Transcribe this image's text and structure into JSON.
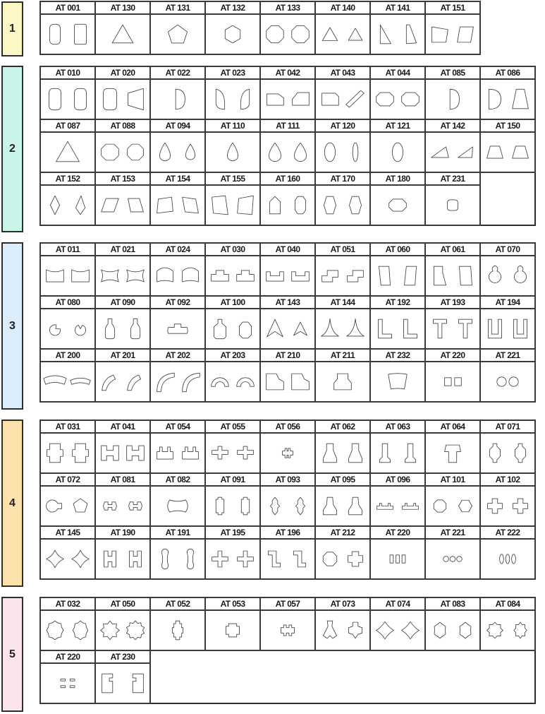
{
  "groups": [
    {
      "label": "1",
      "color": "#fbf8c6",
      "rows": [
        [
          "AT 001",
          "AT 130",
          "AT 131",
          "AT 132",
          "AT 133",
          "AT 140",
          "AT 141",
          "AT 151"
        ]
      ]
    },
    {
      "label": "2",
      "color": "#c9f4ea",
      "rows": [
        [
          "AT 010",
          "AT 020",
          "AT 022",
          "AT 023",
          "AT 042",
          "AT 043",
          "AT 044",
          "AT 085",
          "AT 086"
        ],
        [
          "AT 087",
          "AT 088",
          "AT 094",
          "AT 110",
          "AT 111",
          "AT 120",
          "AT 121",
          "AT 142",
          "AT 150"
        ],
        [
          "AT 152",
          "AT 153",
          "AT 154",
          "AT 155",
          "AT 160",
          "AT 170",
          "AT 180",
          "AT 231"
        ]
      ]
    },
    {
      "label": "3",
      "color": "#dbedfb",
      "rows": [
        [
          "AT 011",
          "AT 021",
          "AT 024",
          "AT 030",
          "AT 040",
          "AT 051",
          "AT 060",
          "AT 061",
          "AT 070"
        ],
        [
          "AT 080",
          "AT 090",
          "AT 092",
          "AT 100",
          "AT 143",
          "AT 144",
          "AT 192",
          "AT 193",
          "AT 194"
        ],
        [
          "AT 200",
          "AT 201",
          "AT 202",
          "AT 203",
          "AT 210",
          "AT 211",
          "AT 232",
          "AT 220",
          "AT 221"
        ]
      ]
    },
    {
      "label": "4",
      "color": "#fce1ad",
      "rows": [
        [
          "AT 031",
          "AT 041",
          "AT 054",
          "AT 055",
          "AT 056",
          "AT 062",
          "AT 063",
          "AT 064",
          "AT 071"
        ],
        [
          "AT 072",
          "AT 081",
          "AT 082",
          "AT 091",
          "AT 093",
          "AT 095",
          "AT 096",
          "AT 101",
          "AT 102"
        ],
        [
          "AT 145",
          "AT 190",
          "AT 191",
          "AT 195",
          "AT 196",
          "AT 212",
          "AT 220",
          "AT 221",
          "AT 222"
        ]
      ]
    },
    {
      "label": "5",
      "color": "#fce4ee",
      "rows": [
        [
          "AT 032",
          "AT 050",
          "AT 052",
          "AT 053",
          "AT 057",
          "AT 073",
          "AT 074",
          "AT 083",
          "AT 084"
        ],
        [
          "AT 220",
          "AT 230"
        ]
      ]
    }
  ]
}
